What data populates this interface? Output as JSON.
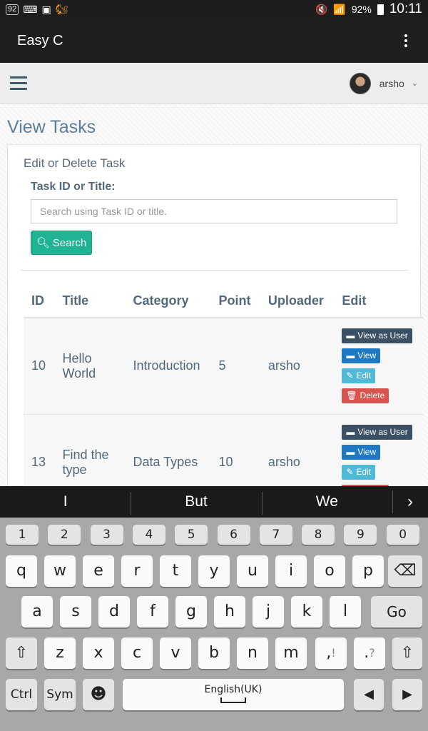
{
  "status_bar": {
    "left_icons": [
      "92",
      "keyboard-icon",
      "image-icon",
      "uc-browser-icon"
    ],
    "battery": "92%",
    "time": "10:11"
  },
  "app_bar": {
    "title": "Easy C"
  },
  "header": {
    "username": "arsho"
  },
  "page": {
    "title": "View Tasks",
    "panel_heading": "Edit or Delete Task",
    "field_label": "Task ID or Title:",
    "search_placeholder": "Search using Task ID or title.",
    "search_button": "Search"
  },
  "table": {
    "columns": [
      "ID",
      "Title",
      "Category",
      "Point",
      "Uploader",
      "Edit"
    ],
    "rows": [
      {
        "id": "10",
        "title": "Hello World",
        "category": "Introduction",
        "point": "5",
        "uploader": "arsho"
      },
      {
        "id": "13",
        "title": "Find the type",
        "category": "Data Types",
        "point": "10",
        "uploader": "arsho"
      }
    ],
    "actions": {
      "view_as_user": "View as User",
      "view": "View",
      "edit": "Edit",
      "delete": "Delete"
    }
  },
  "keyboard": {
    "suggestions": [
      "I",
      "But",
      "We"
    ],
    "number_row": [
      "1",
      "2",
      "3",
      "4",
      "5",
      "6",
      "7",
      "8",
      "9",
      "0"
    ],
    "row1": [
      "q",
      "w",
      "e",
      "r",
      "t",
      "y",
      "u",
      "i",
      "o",
      "p"
    ],
    "row2": [
      "a",
      "s",
      "d",
      "f",
      "g",
      "h",
      "j",
      "k",
      "l"
    ],
    "row3": [
      "z",
      "x",
      "c",
      "v",
      "b",
      "n",
      "m"
    ],
    "go_label": "Go",
    "ctrl_label": "Ctrl",
    "sym_label": "Sym",
    "space_label": "English(UK)",
    "comma_sub": "!",
    "period_sub": "?"
  }
}
